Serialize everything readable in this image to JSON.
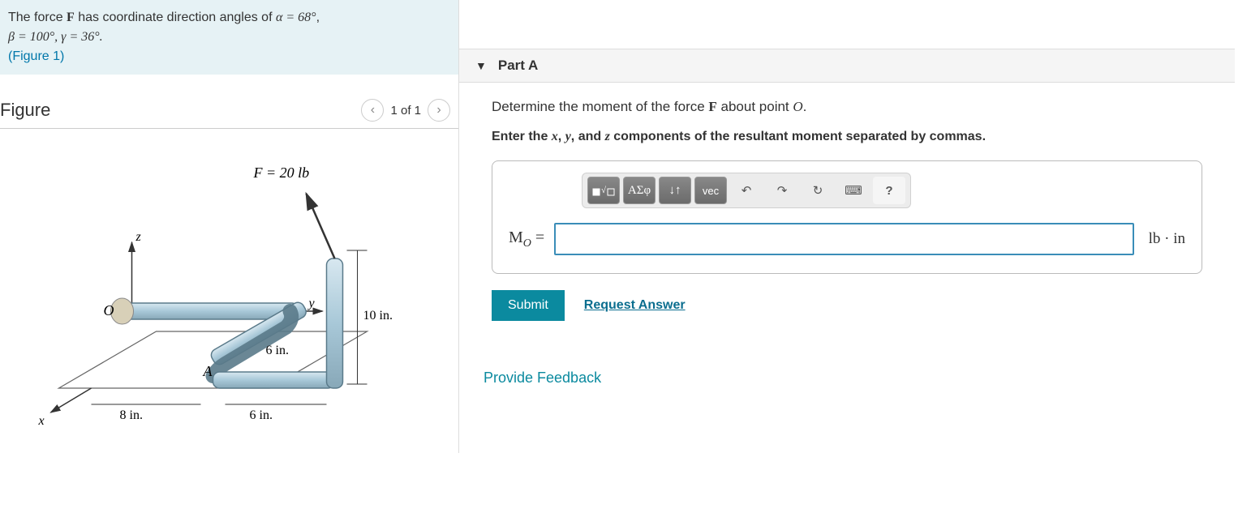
{
  "problem": {
    "line1_pre": "The force ",
    "force_symbol": "F",
    "line1_mid": " has coordinate direction angles of ",
    "alpha_eq": "α = 68°",
    "line2": "β = 100°, γ = 36°.",
    "figure_link": "(Figure 1)"
  },
  "figure": {
    "title": "Figure",
    "nav_label": "1 of 1",
    "labels": {
      "force": "F = 20 lb",
      "z": "z",
      "o": "O",
      "a": "A",
      "x": "x",
      "y": "y",
      "ten_in": "10 in.",
      "six_in_a": "6 in.",
      "six_in_b": "6 in.",
      "eight_in": "8 in."
    }
  },
  "part": {
    "header": "Part A",
    "prompt_pre": "Determine the moment of the force ",
    "prompt_force": "F",
    "prompt_mid": " about point ",
    "prompt_point": "O",
    "prompt_end": ".",
    "instruction_pre": "Enter the ",
    "inst_x": "x",
    "inst_comma1": ", ",
    "inst_y": "y",
    "inst_comma2": ", and ",
    "inst_z": "z",
    "instruction_post": " components of the resultant moment separated by commas.",
    "toolbar": {
      "templates": "▢√▢",
      "greek": "ΑΣφ",
      "subsup": "↓↑",
      "vec": "vec",
      "undo": "↶",
      "redo": "↷",
      "reset": "↻",
      "keyboard": "⌨",
      "help": "?"
    },
    "answer_label_M": "M",
    "answer_label_sub": "O",
    "answer_label_eq": " =",
    "answer_value": "",
    "units": "lb · in",
    "submit": "Submit",
    "request": "Request Answer"
  },
  "feedback": "Provide Feedback"
}
